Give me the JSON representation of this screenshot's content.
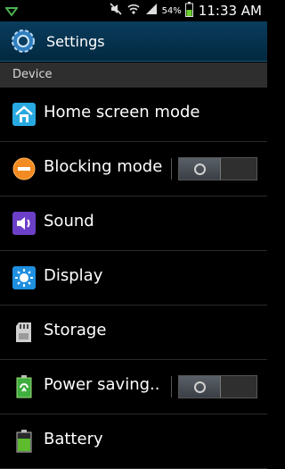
{
  "status_bar": {
    "battery_percent": "54%",
    "time": "11:33 AM"
  },
  "header": {
    "title": "Settings"
  },
  "section": {
    "title": "Device"
  },
  "rows": [
    {
      "label": "Home screen mode"
    },
    {
      "label": "Blocking mode",
      "toggle": "off"
    },
    {
      "label": "Sound"
    },
    {
      "label": "Display"
    },
    {
      "label": "Storage"
    },
    {
      "label": "Power saving..",
      "toggle": "off"
    },
    {
      "label": "Battery"
    }
  ],
  "colors": {
    "title_bar": "#0a3d5e",
    "section_bg": "#2e2e2e",
    "accent_blue": "#29a9e1"
  }
}
